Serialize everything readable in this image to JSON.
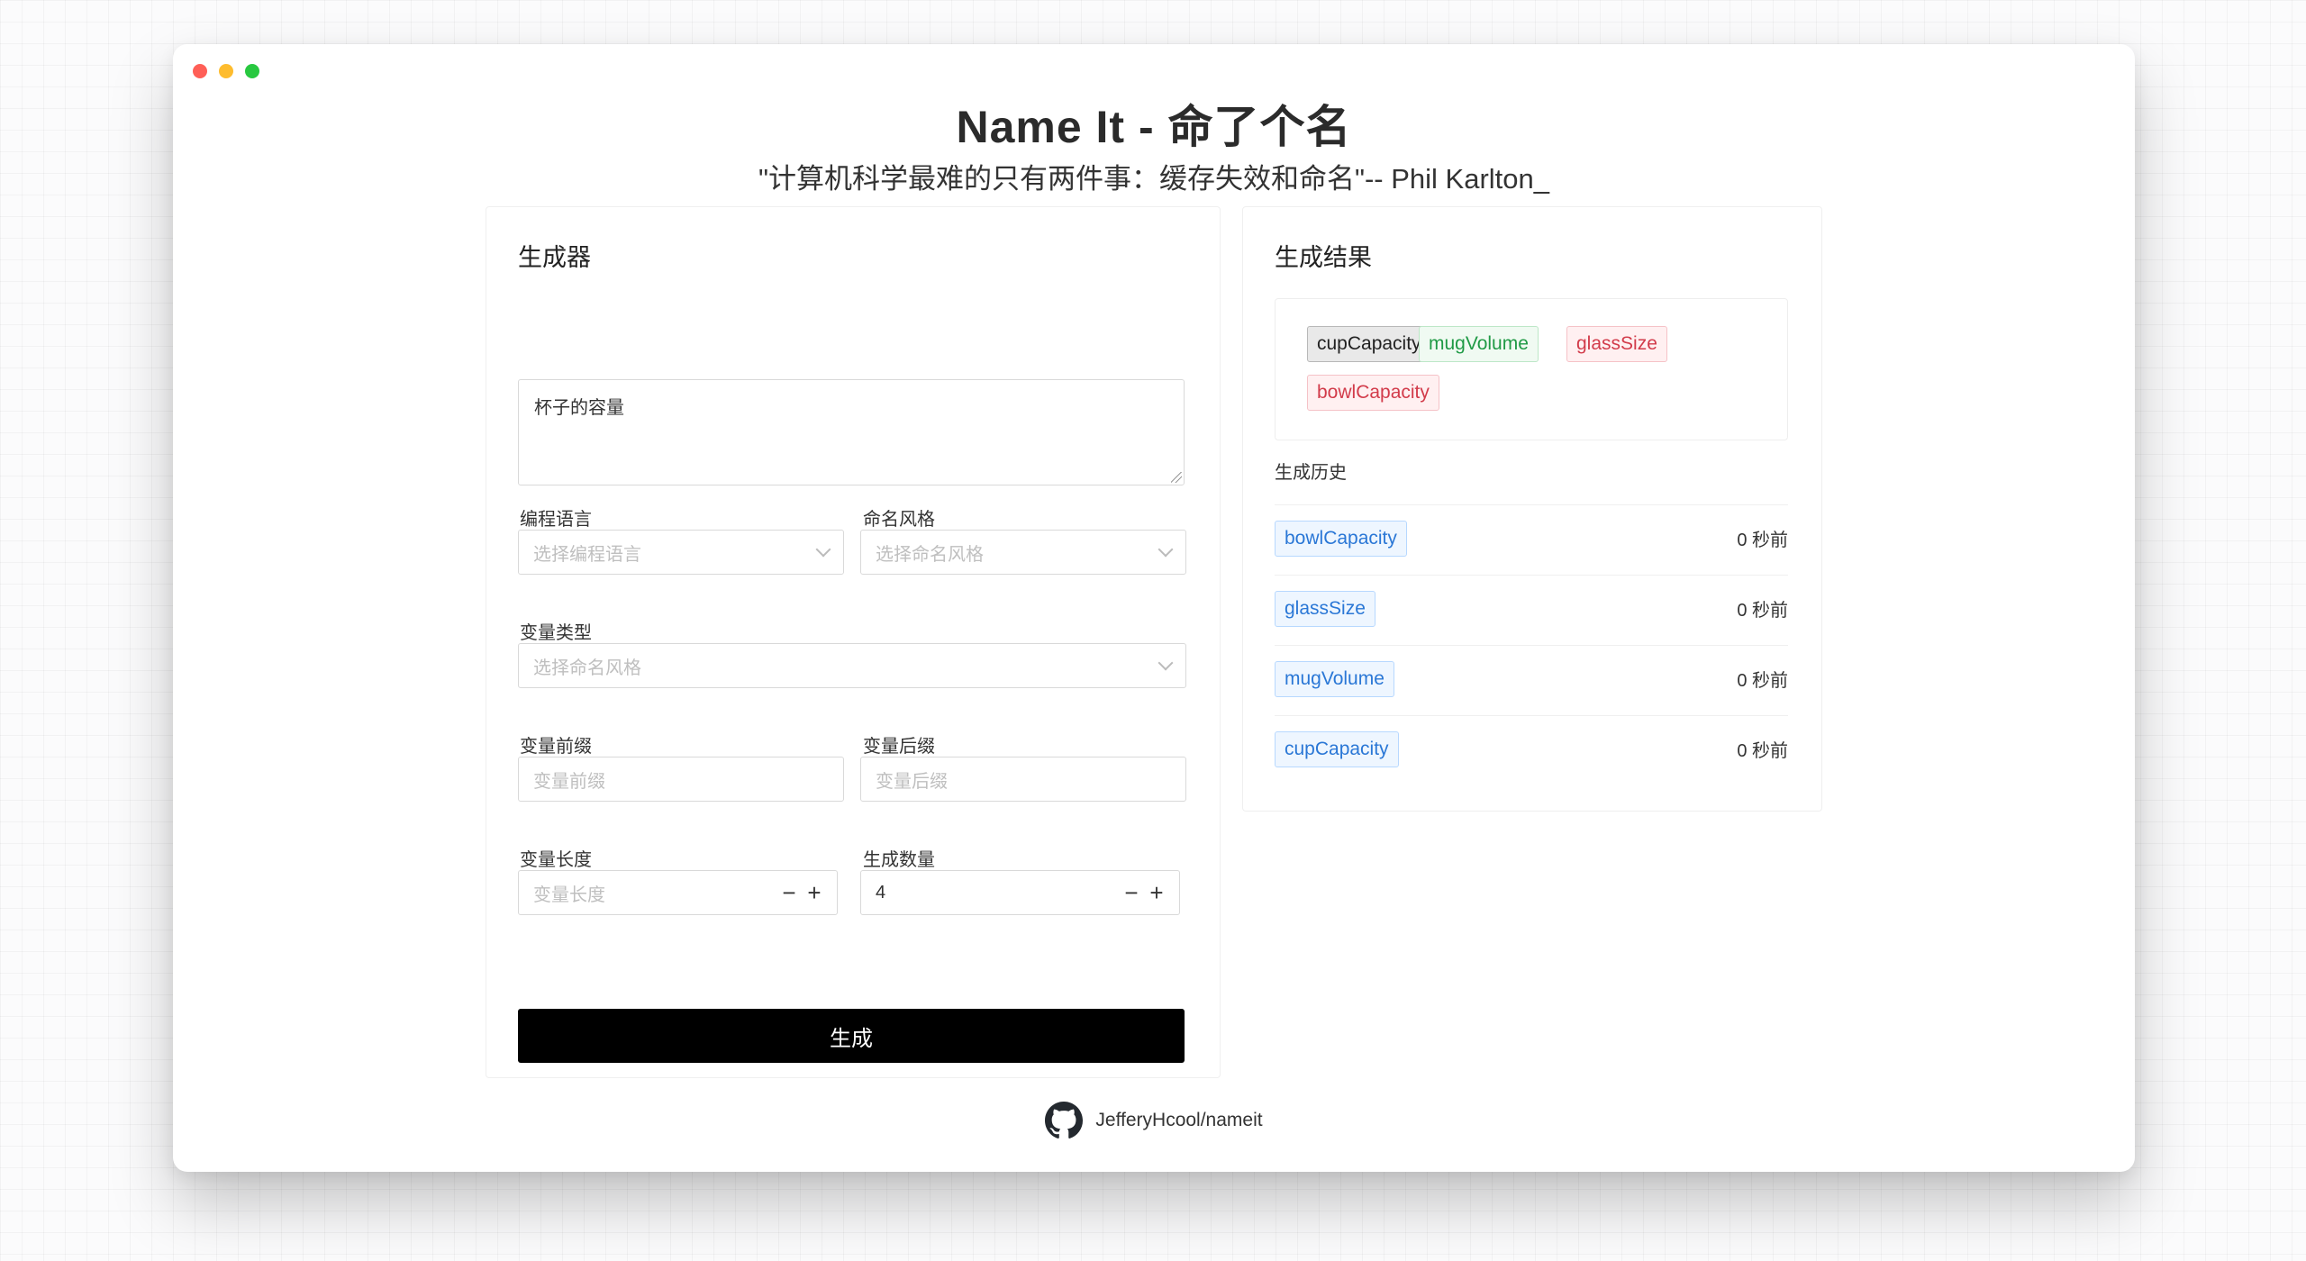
{
  "header": {
    "title": "Name It - 命了个名",
    "subtitle": "\"计算机科学最难的只有两件事：缓存失效和命名\"-- Phil Karlton_"
  },
  "generator": {
    "title": "生成器",
    "description": "杯子的容量",
    "language": {
      "label": "编程语言",
      "placeholder": "选择编程语言"
    },
    "style": {
      "label": "命名风格",
      "placeholder": "选择命名风格"
    },
    "var_type": {
      "label": "变量类型",
      "placeholder": "选择命名风格"
    },
    "prefix": {
      "label": "变量前缀",
      "placeholder": "变量前缀"
    },
    "suffix": {
      "label": "变量后缀",
      "placeholder": "变量后缀"
    },
    "length": {
      "label": "变量长度",
      "placeholder": "变量长度"
    },
    "count": {
      "label": "生成数量",
      "value": "4"
    },
    "stepper": {
      "minus": "−",
      "plus": "+"
    },
    "button": "生成"
  },
  "results": {
    "title": "生成结果",
    "tags": [
      {
        "label": "cupCapacity",
        "color": "#e9e9e9"
      },
      {
        "label": "mugVolume",
        "color": "#1f9a45"
      },
      {
        "label": "glassSize",
        "color": "#d23b4a"
      },
      {
        "label": "bowlCapacity",
        "color": "#d23b4a"
      }
    ],
    "history_label": "生成历史",
    "history": [
      {
        "name": "bowlCapacity",
        "time": "0 秒前"
      },
      {
        "name": "glassSize",
        "time": "0 秒前"
      },
      {
        "name": "mugVolume",
        "time": "0 秒前"
      },
      {
        "name": "cupCapacity",
        "time": "0 秒前"
      }
    ]
  },
  "footer": {
    "icon": "github-icon",
    "link": "JefferyHcool/nameit"
  },
  "colors": {
    "button_bg": "#000000",
    "history_tag": "#2a77d6"
  }
}
